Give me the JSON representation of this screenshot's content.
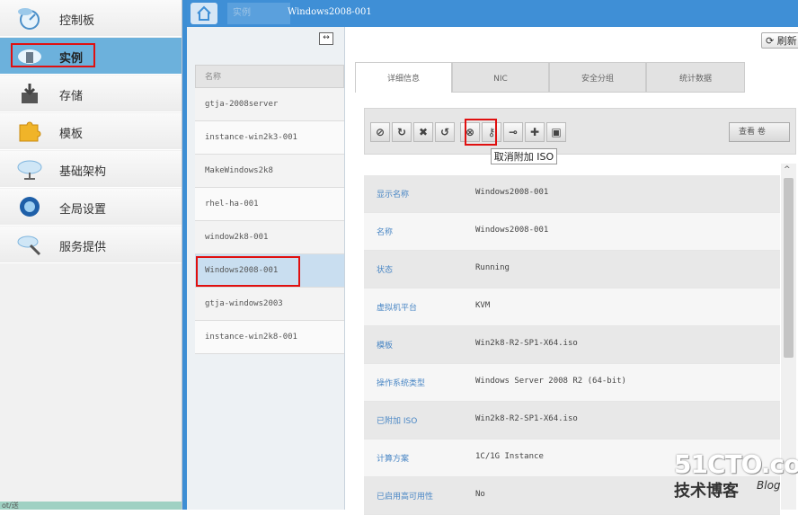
{
  "sidebar": {
    "items": [
      {
        "label": "控制板",
        "icon": "dashboard-icon"
      },
      {
        "label": "实例",
        "icon": "instance-cloud-icon"
      },
      {
        "label": "存储",
        "icon": "storage-icon"
      },
      {
        "label": "模板",
        "icon": "puzzle-icon"
      },
      {
        "label": "基础架构",
        "icon": "infrastructure-cloud-icon"
      },
      {
        "label": "全局设置",
        "icon": "global-settings-icon"
      },
      {
        "label": "服务提供",
        "icon": "service-offering-icon"
      }
    ],
    "bottom_text": "ot/送"
  },
  "breadcrumb": {
    "home_icon": "home-icon",
    "section": "实例",
    "current": "Windows2008-001"
  },
  "instance_list": {
    "header": "名称",
    "rows": [
      "gtja-2008server",
      "instance-win2k3-001",
      "MakeWindows2k8",
      "rhel-ha-001",
      "window2k8-001",
      "Windows2008-001",
      "gtja-windows2003",
      "instance-win2k8-001"
    ]
  },
  "detail": {
    "refresh_label": "刷新",
    "tabs": [
      "详细信息",
      "NIC",
      "安全分组",
      "统计数据"
    ],
    "toolbar_icons": [
      "stop-icon",
      "reboot-icon",
      "destroy-icon",
      "restore-icon",
      "attach-iso-icon",
      "reset-password-icon",
      "change-service-icon",
      "migrate-icon",
      "console-icon"
    ],
    "view_label": "查看 卷",
    "tooltip": "取消附加 ISO",
    "properties": [
      {
        "key": "显示名称",
        "value": "Windows2008-001"
      },
      {
        "key": "名称",
        "value": "Windows2008-001"
      },
      {
        "key": "状态",
        "value": "Running"
      },
      {
        "key": "虚拟机平台",
        "value": "KVM"
      },
      {
        "key": "模板",
        "value": "Win2k8-R2-SP1-X64.iso"
      },
      {
        "key": "操作系统类型",
        "value": "Windows Server 2008 R2 (64-bit)"
      },
      {
        "key": "已附加 ISO",
        "value": "Win2k8-R2-SP1-X64.iso"
      },
      {
        "key": "计算方案",
        "value": "1C/1G Instance"
      },
      {
        "key": "已启用高可用性",
        "value": "No"
      }
    ]
  },
  "watermark": {
    "big": "51CTO.com",
    "small": "技术博客",
    "blog": "Blog"
  },
  "colors": {
    "accent": "#3f8fd6",
    "active_nav": "#6cb1dc",
    "highlight_red": "#e01010"
  }
}
